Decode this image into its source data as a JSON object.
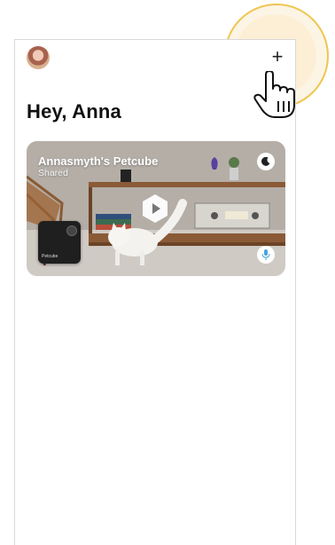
{
  "greeting": "Hey, Anna",
  "add_button_symbol": "+",
  "camera_card": {
    "title": "Annasmyth's Petcube",
    "subtitle": "Shared",
    "device_label": "Petcube"
  },
  "icons": {
    "avatar": "user-avatar",
    "add": "plus-icon",
    "night_mode": "moon-icon",
    "play": "play-icon",
    "microphone": "microphone-icon",
    "cursor": "hand-pointer-icon"
  },
  "colors": {
    "highlight_ring": "#f0c552",
    "highlight_fill": "#fcefd6",
    "mic_icon": "#4aa3df",
    "text_primary": "#111111"
  }
}
